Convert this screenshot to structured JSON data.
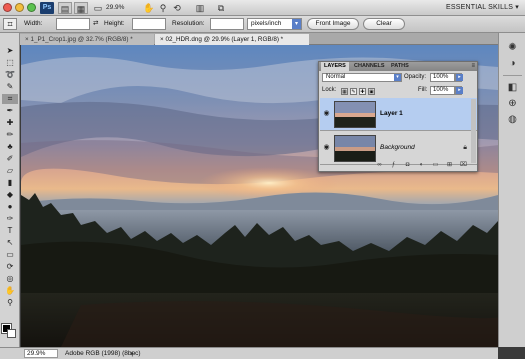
{
  "app": {
    "icons": [
      "traffic-close",
      "traffic-minimize",
      "traffic-zoom",
      "photoshop-logo",
      "hand-icon",
      "zoom-icon",
      "rotate-icon",
      "screen-mode-icon",
      "arrange-icon"
    ],
    "logo_text": "Ps",
    "zoom_value": "29.9%",
    "workspace": "ESSENTIAL SKILLS",
    "workspace_arrow": "▾"
  },
  "options_bar": {
    "width_label": "Width:",
    "height_label": "Height:",
    "resolution_label": "Resolution:",
    "resolution_unit": "pixels/inch",
    "front_image_label": "Front Image",
    "clear_label": "Clear"
  },
  "tabs": [
    {
      "label": "1_P1_Crop1.jpg @ 32.7% (RGB/8) *",
      "close": "×"
    },
    {
      "label": "02_HDR.dng @ 29.9% (Layer 1, RGB/8) *",
      "close": "×"
    }
  ],
  "layers_panel": {
    "tabs": [
      "LAYERS",
      "CHANNELS",
      "PATHS"
    ],
    "menu_icon": "≡",
    "blend_mode": "Normal",
    "opacity_label": "Opacity:",
    "opacity_value": "100%",
    "lock_label": "Lock:",
    "fill_label": "Fill:",
    "fill_value": "100%",
    "layers": [
      {
        "name": "Layer 1",
        "selected": true,
        "locked": false
      },
      {
        "name": "Background",
        "selected": false,
        "locked": true
      }
    ],
    "footer_icons": [
      "link-icon",
      "fx-icon",
      "mask-icon",
      "adjustment-icon",
      "group-icon",
      "new-layer-icon",
      "trash-icon"
    ]
  },
  "status_bar": {
    "zoom": "29.9%",
    "doc_info": "Adobe RGB (1998) (8bpc)",
    "arrow": "▸"
  },
  "colors": {
    "accent": "#5a7fc8",
    "selection": "#b5cdf0"
  }
}
